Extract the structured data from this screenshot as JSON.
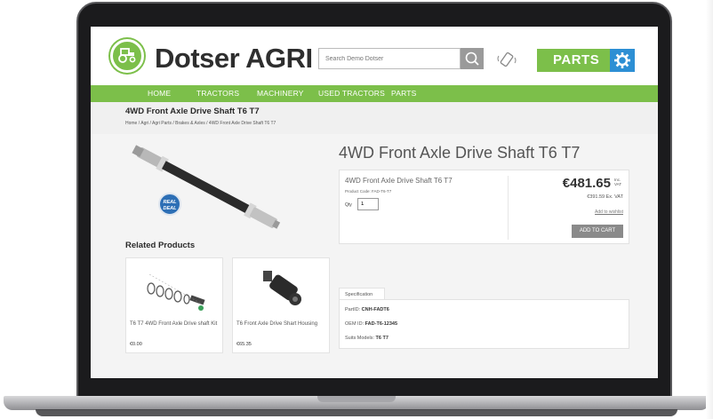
{
  "brand": {
    "name": "Dotser AGRI"
  },
  "search": {
    "placeholder": "Search Demo Dotser"
  },
  "header": {
    "parts_label": "PARTS"
  },
  "nav": {
    "items": [
      "HOME",
      "TRACTORS",
      "MACHINERY",
      "USED TRACTORS",
      "PARTS"
    ]
  },
  "breadcrumb": {
    "title": "4WD Front Axle Drive Shaft T6 T7",
    "path": "Home /  Agri  /  Agri Parts  /  Brakes & Axles  /  4WD Front Axle Drive Shaft T6 T7"
  },
  "badge": {
    "line1": "REAL",
    "line2": "DEAL"
  },
  "product": {
    "title": "4WD Front Axle Drive Shaft T6 T7",
    "name": "4WD Front Axle Drive Shaft T6 T7",
    "code": "Product Code: FAD-T6-T7",
    "qty_label": "Qty",
    "qty_value": "1",
    "price": "€481.65",
    "price_inc": "Inc. VAT",
    "price_ex": "€391.59 Ex. VAT",
    "wishlist": "Add to wishlist",
    "add_to_cart": "ADD TO CART"
  },
  "related": {
    "heading": "Related Products",
    "items": [
      {
        "name": "T6 T7 4WD Front Axle Drive shaft Kit",
        "price": "€0.00"
      },
      {
        "name": "T6 Front Axle Drive Shart Housing",
        "price": "€65.35"
      }
    ]
  },
  "spec": {
    "tab": "Specification",
    "rows": [
      {
        "label": "PartID: ",
        "value": "CNH-FADT6"
      },
      {
        "label": "OEM ID: ",
        "value": "FAD-T6-12345"
      },
      {
        "label": "Suits Models: ",
        "value": "T6 T7"
      }
    ]
  },
  "colors": {
    "green": "#7cbf4a",
    "blue": "#2d8fd4",
    "badge_blue": "#2d6fb5"
  }
}
